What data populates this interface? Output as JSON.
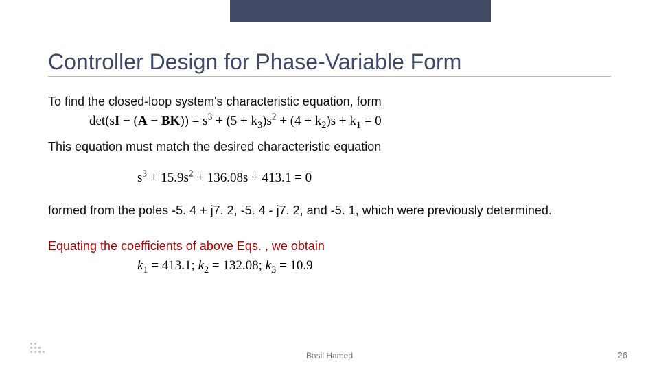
{
  "title": "Controller Design for Phase-Variable Form",
  "line1": "To find the closed-loop system's characteristic equation, form",
  "line2": "This equation must match the desired characteristic equation",
  "line3": "formed from the poles -5. 4 + j7. 2, -5. 4 - j7. 2, and -5. 1, which were previously determined.",
  "line4": "Equating the coefficients of  above Eqs. , we obtain",
  "footer_author": "Basil Hamed",
  "footer_page": "26",
  "eq1": {
    "label": "det(s",
    "mat_open": "I",
    "minus": " − (",
    "A": "A",
    "m2": " − ",
    "B": "B",
    "K": "K",
    "close": ")) = s",
    "k3": " + (5 + k",
    "k3b": ")s",
    "k2": " + (4 + k",
    "k2b": ")s + k",
    "end": " = 0",
    "p3": "3",
    "p2": "2",
    "s1": "1",
    "s2": "2",
    "s3": "3"
  },
  "eq2": {
    "a": "s",
    "b": " + 15.9s",
    "c": " + 136.08s + 413.1 = 0",
    "p3": "3",
    "p2": "2"
  },
  "eq3": {
    "k1l": "k",
    "k1v": " = 413.1;    ",
    "k2l": "k",
    "k2v": " = 132.08;    ",
    "k3l": "k",
    "k3v": " = 10.9",
    "s1": "1",
    "s2": "2",
    "s3": "3"
  }
}
